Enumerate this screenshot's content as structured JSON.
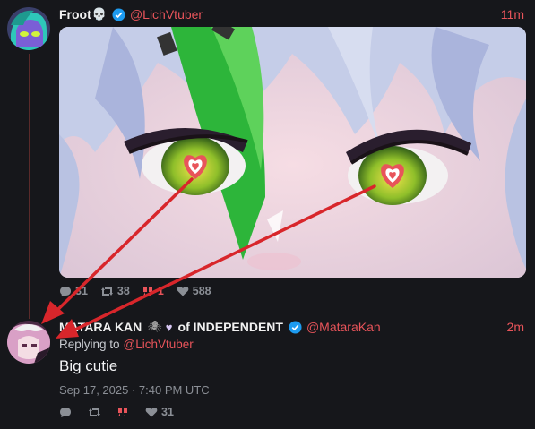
{
  "post1": {
    "author_name": "Froot",
    "author_emoji": "💀",
    "handle": "@LichVtuber",
    "time": "11m",
    "stats": {
      "replies": "31",
      "reposts": "38",
      "quotes": "1",
      "likes": "588"
    }
  },
  "post2": {
    "author_name": "MATARA KAN",
    "author_suffix": "of INDEPENDENT",
    "handle": "@MataraKan",
    "time": "2m",
    "replying_prefix": "Replying to",
    "replying_handle": "@LichVtuber",
    "text": "Big cutie",
    "date": "Sep 17, 2025 · 7:40 PM UTC",
    "stats": {
      "likes": "31"
    }
  },
  "icons": {
    "verified": "verified-badge-icon",
    "reply": "speech-bubble-icon",
    "repost": "repost-icon",
    "quote": "quote-icon",
    "like": "heart-icon",
    "spider": "spider-icon",
    "heart": "lavender-heart-icon"
  },
  "colors": {
    "background": "#16171b",
    "accent": "#e8545a",
    "verified": "#1d9bf0",
    "muted": "#8b8f96"
  }
}
